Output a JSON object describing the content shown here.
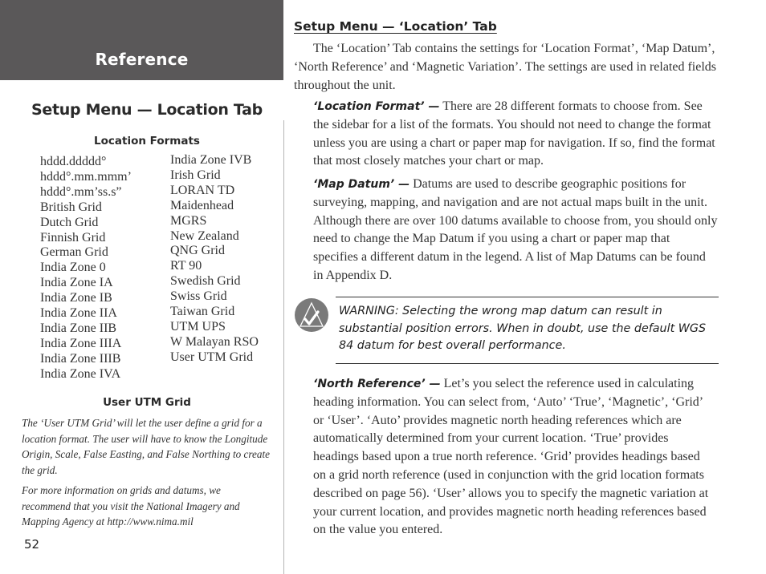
{
  "header": {
    "section_label": "Reference"
  },
  "sidebar": {
    "title": "Setup Menu — Location Tab",
    "formats_heading": "Location Formats",
    "formats_column_1": [
      "hddd.ddddd°",
      "hddd°.mm.mmm’",
      "hddd°.mm’ss.s”",
      "British Grid",
      "Dutch Grid",
      "Finnish Grid",
      "German Grid",
      "India Zone 0",
      "India Zone IA",
      "India Zone IB",
      "India Zone IIA",
      "India Zone IIB",
      "India Zone IIIA",
      "India Zone IIIB",
      "India Zone IVA"
    ],
    "formats_column_2": [
      "India Zone IVB",
      "Irish Grid",
      "LORAN TD",
      "Maidenhead",
      "MGRS",
      "New Zealand",
      "QNG Grid",
      "RT 90",
      "Swedish Grid",
      "Swiss Grid",
      "Taiwan Grid",
      "UTM UPS",
      "W Malayan RSO",
      "User UTM Grid"
    ],
    "utm_heading": "User UTM Grid",
    "utm_note": "The ‘User UTM Grid’ will let the user define a grid for a location format.  The user will have to know the Longitude Origin, Scale, False Easting, and False Northing to create the grid.",
    "nima_note": "For more information on grids and datums, we recommend that you visit the National Imagery and Mapping Agency at http://www.nima.mil"
  },
  "page_number": "52",
  "main": {
    "heading": "Setup Menu — ‘Location’ Tab",
    "intro": "The ‘Location’ Tab contains the settings for ‘Location Format’, ‘Map Datum’, ‘North Reference’ and ‘Magnetic Variation’.  The settings are used in related fields throughout the unit.",
    "location_format": {
      "term": "‘Location Format’ —",
      "text": " There are 28 different formats to choose from.  See the sidebar for a list of the formats. You should not need to change the format unless you are using a chart or paper map for navigation.  If so, find the format that most closely matches your chart or map."
    },
    "map_datum": {
      "term": "‘Map Datum’ —",
      "text": " Datums are used to describe geographic positions for surveying, mapping, and navigation and are not actual maps built in the unit. Although there are over 100 datums available to choose from, you should only need to change the Map Datum if you using a chart or paper map that specifies a different datum in the legend.  A list of Map Datums can be found in Appendix D."
    },
    "warning": {
      "icon": "warning-check-icon",
      "text": "WARNING: Selecting the wrong map datum can result in substantial position errors.  When in doubt, use the default WGS 84 datum for best overall performance."
    },
    "north_reference": {
      "term": "‘North Reference’ —",
      "text": "  Let’s you select the reference used in calculating heading information.  You can select from, ‘Auto’ ‘True’, ‘Magnetic’, ‘Grid’ or ‘User’. ‘Auto’ provides magnetic north heading references which are automatically determined from your current location.  ‘True’ provides headings based upon a true north reference.  ‘Grid’ provides headings based on a grid north reference (used in conjunction with the grid location formats described on page 56).  ‘User’ allows you to specify the magnetic variation at your current location, and provides magnetic north heading references based on the value you entered."
    }
  },
  "colors": {
    "header_background": "#5a5859",
    "header_text": "#ffffff",
    "icon_fill": "#7a7a7a",
    "body_text": "#333333"
  }
}
